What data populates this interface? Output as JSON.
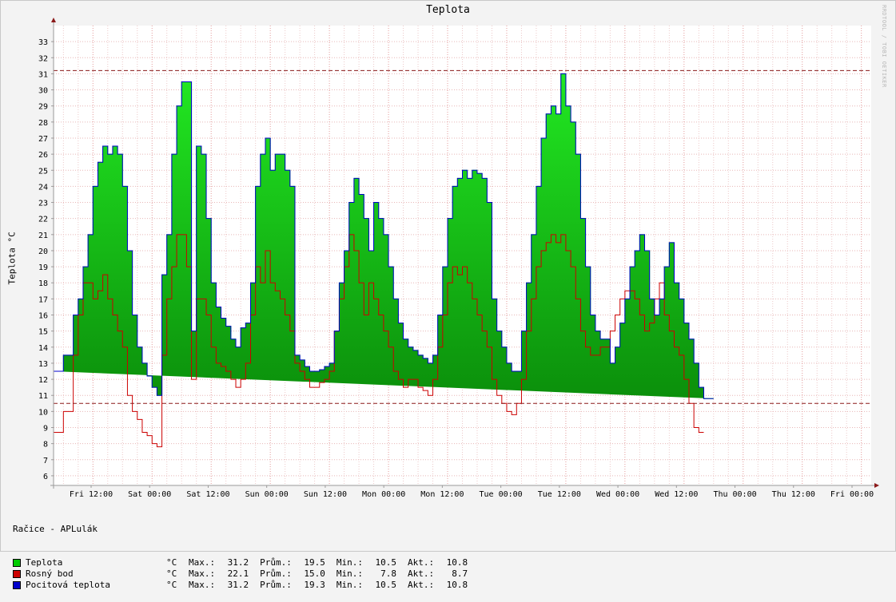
{
  "chart_data": {
    "type": "area",
    "title": "Teplota",
    "ylabel": "Teplota °C",
    "watermark": "RRDTOOL / TOBI OETIKER",
    "ylim": [
      5.4,
      34
    ],
    "yticks": [
      6,
      7,
      8,
      9,
      10,
      11,
      12,
      13,
      14,
      15,
      16,
      17,
      18,
      19,
      20,
      21,
      22,
      23,
      24,
      25,
      26,
      27,
      28,
      29,
      30,
      31,
      32,
      33
    ],
    "x_range_hours": [
      -32,
      108
    ],
    "xticks": [
      {
        "label": "Fri 12:00",
        "hour": -24
      },
      {
        "label": "Sat 00:00",
        "hour": -12
      },
      {
        "label": "Sat 12:00",
        "hour": 0
      },
      {
        "label": "Sun 00:00",
        "hour": 12
      },
      {
        "label": "Sun 12:00",
        "hour": 24
      },
      {
        "label": "Mon 00:00",
        "hour": 36
      },
      {
        "label": "Mon 12:00",
        "hour": 48
      },
      {
        "label": "Tue 00:00",
        "hour": 60
      },
      {
        "label": "Tue 12:00",
        "hour": 72
      },
      {
        "label": "Wed 00:00",
        "hour": 84
      },
      {
        "label": "Wed 12:00",
        "hour": 96
      },
      {
        "label": "Thu 00:00",
        "hour": 108
      },
      {
        "label": "Thu 12:00",
        "hour": 120
      },
      {
        "label": "Fri 00:00",
        "hour": 132
      }
    ],
    "hlines": [
      {
        "value": 31.2,
        "color": "#8b1a1a"
      },
      {
        "value": 10.5,
        "color": "#8b1a1a"
      }
    ],
    "x_hours": [
      -32,
      -30,
      -28,
      -27,
      -26,
      -25,
      -24,
      -23,
      -22,
      -21,
      -20,
      -19,
      -18,
      -17,
      -16,
      -15,
      -14,
      -13,
      -12,
      -11,
      -10,
      -9,
      -8,
      -7,
      -6,
      -5,
      -4,
      -3,
      -2,
      -1,
      0,
      1,
      2,
      3,
      4,
      5,
      6,
      7,
      8,
      9,
      10,
      11,
      12,
      13,
      14,
      15,
      16,
      17,
      18,
      19,
      20,
      21,
      22,
      23,
      24,
      25,
      26,
      27,
      28,
      29,
      30,
      31,
      32,
      33,
      34,
      35,
      36,
      37,
      38,
      39,
      40,
      41,
      42,
      43,
      44,
      45,
      46,
      47,
      48,
      49,
      50,
      51,
      52,
      53,
      54,
      55,
      56,
      57,
      58,
      59,
      60,
      61,
      62,
      63,
      64,
      65,
      66,
      67,
      68,
      69,
      70,
      71,
      72,
      73,
      74,
      75,
      76,
      77,
      78,
      79,
      80,
      81,
      82,
      83,
      84,
      85,
      86,
      87,
      88,
      89,
      90,
      91,
      92,
      93,
      94,
      95,
      96,
      97,
      98,
      99,
      100,
      101,
      102,
      103,
      104,
      105,
      106,
      107,
      108,
      109,
      110,
      111,
      112,
      113,
      114,
      115,
      116,
      117,
      118,
      119,
      120,
      121,
      122,
      123,
      124,
      125,
      126,
      127,
      128,
      129,
      130,
      131,
      132,
      133,
      134
    ],
    "series": [
      {
        "name": "Teplota",
        "color": "#00cc00",
        "values": [
          12.5,
          13.5,
          16,
          17,
          19,
          21,
          24,
          25.5,
          26.5,
          26,
          26.5,
          26,
          24,
          20,
          16,
          14,
          13,
          12.2,
          11.5,
          11,
          18.5,
          21,
          26,
          29,
          30.5,
          30.5,
          15,
          26.5,
          26,
          22,
          18,
          16.5,
          15.8,
          15.3,
          14.5,
          14,
          15.2,
          15.5,
          18,
          24,
          26,
          27,
          25,
          26,
          26,
          25,
          24,
          13.5,
          13.2,
          12.8,
          12.5,
          12.5,
          12.6,
          12.8,
          13,
          15,
          18,
          20,
          23,
          24.5,
          23.5,
          22,
          20,
          23,
          22,
          21,
          19,
          17,
          15.5,
          14.5,
          14,
          13.8,
          13.5,
          13.3,
          13,
          13.5,
          16,
          19,
          22,
          24,
          24.5,
          25,
          24.5,
          25,
          24.8,
          24.5,
          23,
          17,
          15,
          14,
          13,
          12.5,
          12.5,
          15,
          18,
          21,
          24,
          27,
          28.5,
          29,
          28.5,
          31,
          29,
          28,
          26,
          22,
          19,
          16,
          15,
          14.5,
          14.5,
          13,
          14,
          15.5,
          17,
          19,
          20,
          21,
          20,
          17,
          16,
          17,
          19,
          20.5,
          18,
          17,
          15.5,
          14.5,
          13,
          11.5,
          10.8,
          10.8
        ]
      },
      {
        "name": "Rosný bod",
        "color": "#cc0000",
        "values": [
          8.7,
          10,
          13.5,
          16,
          18,
          18,
          17,
          17.5,
          18.5,
          17,
          16,
          15,
          14,
          11,
          10,
          9.5,
          8.7,
          8.5,
          8,
          7.8,
          13.5,
          17,
          19,
          21,
          21,
          19,
          12,
          17,
          17,
          16,
          14,
          13,
          12.8,
          12.5,
          12,
          11.5,
          12,
          13,
          16,
          19,
          18,
          20,
          18,
          17.5,
          17,
          16,
          15,
          13,
          12.5,
          12,
          11.5,
          11.5,
          11.8,
          12,
          12.5,
          15,
          17,
          19,
          21,
          20,
          18,
          16,
          18,
          17,
          16,
          15,
          14,
          12.5,
          12,
          11.5,
          12,
          12,
          11.5,
          11.3,
          11,
          12,
          14,
          16,
          18,
          19,
          18.5,
          19,
          18,
          17,
          16,
          15,
          14,
          12,
          11,
          10.5,
          10,
          9.8,
          10.5,
          12,
          15,
          17,
          19,
          20,
          20.5,
          21,
          20.5,
          21,
          20,
          19,
          17,
          15,
          14,
          13.5,
          13.5,
          14,
          14,
          15,
          16,
          17,
          17.5,
          17.5,
          17,
          16,
          15,
          15.5,
          17,
          18,
          16,
          15,
          14,
          13.5,
          12,
          10.5,
          9,
          8.7
        ]
      },
      {
        "name": "Pocitová teplota",
        "color": "#0000cc",
        "values": [
          12.5,
          13.5,
          16,
          17,
          19,
          21,
          24,
          25.5,
          26.5,
          26,
          26.5,
          26,
          24,
          20,
          16,
          14,
          13,
          12.2,
          11.5,
          11,
          18.5,
          21,
          26,
          29,
          30.5,
          30.5,
          15,
          26.5,
          26,
          22,
          18,
          16.5,
          15.8,
          15.3,
          14.5,
          14,
          15.2,
          15.5,
          18,
          24,
          26,
          27,
          25,
          26,
          26,
          25,
          24,
          13.5,
          13.2,
          12.8,
          12.5,
          12.5,
          12.6,
          12.8,
          13,
          15,
          18,
          20,
          23,
          24.5,
          23.5,
          22,
          20,
          23,
          22,
          21,
          19,
          17,
          15.5,
          14.5,
          14,
          13.8,
          13.5,
          13.3,
          13,
          13.5,
          16,
          19,
          22,
          24,
          24.5,
          25,
          24.5,
          25,
          24.8,
          24.5,
          23,
          17,
          15,
          14,
          13,
          12.5,
          12.5,
          15,
          18,
          21,
          24,
          27,
          28.5,
          29,
          28.5,
          31,
          29,
          28,
          26,
          22,
          19,
          16,
          15,
          14.5,
          14.5,
          13,
          14,
          15.5,
          17,
          19,
          20,
          21,
          20,
          17,
          16,
          17,
          19,
          20.5,
          18,
          17,
          15.5,
          14.5,
          13,
          11.5,
          10.8,
          10.8
        ]
      }
    ]
  },
  "legend": {
    "heading": "Račice - APLulák",
    "headers": {
      "max": "Max.:",
      "avg": "Prům.:",
      "min": "Min.:",
      "cur": "Akt.:"
    },
    "rows": [
      {
        "name": "Teplota",
        "unit": "°C",
        "max": "31.2",
        "avg": "19.5",
        "min": "10.5",
        "cur": "10.8",
        "color": "#00cc00"
      },
      {
        "name": "Rosný bod",
        "unit": "°C",
        "max": "22.1",
        "avg": "15.0",
        "min": "7.8",
        "cur": "8.7",
        "color": "#cc0000"
      },
      {
        "name": "Pocitová teplota",
        "unit": "°C",
        "max": "31.2",
        "avg": "19.3",
        "min": "10.5",
        "cur": "10.8",
        "color": "#0000cc"
      }
    ]
  }
}
